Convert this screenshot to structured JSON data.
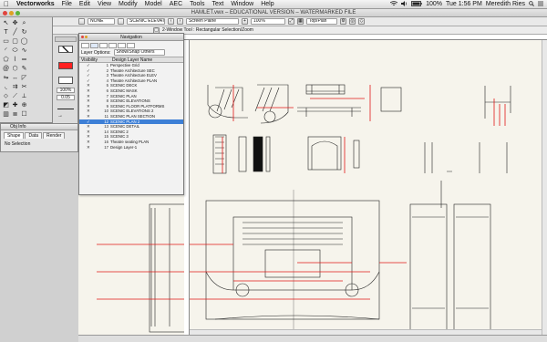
{
  "menubar": {
    "apple": "",
    "items": [
      "Vectorworks",
      "File",
      "Edit",
      "View",
      "Modify",
      "Model",
      "AEC",
      "Tools",
      "Text",
      "Window",
      "Help"
    ],
    "status_percent": "100%",
    "clock": "Tue 1:56 PM",
    "user": "Meredith Ries"
  },
  "window": {
    "title": "HAMLET.vwx – EDUCATIONAL VERSION – WATERMARKED FILE"
  },
  "viewbar": {
    "class_combo": "NONE",
    "layer_combo": "SCENIC ELEVATIONS",
    "view_combo": "Screen Plane",
    "zoom_combo": "100%",
    "render_combo": "Top/Plan"
  },
  "modebar": {
    "text": "2-Window Tool : Rectangular Selection/Zoom"
  },
  "attributes": {
    "fill_color": "#ff2020",
    "pen_color": "#ffffff",
    "opacity_field": "100%",
    "line_field": "0.05"
  },
  "objinfo": {
    "title": "Obj Info",
    "tabs": [
      "Shape",
      "Data",
      "Render"
    ],
    "selection": "No Selection"
  },
  "navigation": {
    "title": "Navigation",
    "option_label": "Layer Options:",
    "option_value": "Show/Snap Others",
    "col_visibility": "Visibility",
    "col_name": "Design Layer Name",
    "layers": [
      {
        "vis": "✓",
        "num": "1",
        "name": "Perspective Grid",
        "selected": false
      },
      {
        "vis": "✓",
        "num": "2",
        "name": "Theatre Architecture SEC",
        "selected": false
      },
      {
        "vis": "✓",
        "num": "3",
        "name": "Theatre Architecture ELEV",
        "selected": false
      },
      {
        "vis": "✓",
        "num": "4",
        "name": "Theatre Architecture PLAN",
        "selected": false
      },
      {
        "vis": "✕",
        "num": "5",
        "name": "SCENIC DECK",
        "selected": false
      },
      {
        "vis": "✕",
        "num": "6",
        "name": "SCENIC MASK",
        "selected": false
      },
      {
        "vis": "✕",
        "num": "7",
        "name": "SCENIC PLAN",
        "selected": false
      },
      {
        "vis": "✕",
        "num": "8",
        "name": "SCENIC ELEVATIONS",
        "selected": false
      },
      {
        "vis": "✕",
        "num": "9",
        "name": "SCENIC FLOOR PLATFORMS",
        "selected": false
      },
      {
        "vis": "✕",
        "num": "10",
        "name": "SCENIC ELEVATIONS 2",
        "selected": false
      },
      {
        "vis": "✕",
        "num": "11",
        "name": "SCENIC PLAN SECTION",
        "selected": false
      },
      {
        "vis": "✓",
        "num": "12",
        "name": "SCENIC PLAN 2",
        "selected": true
      },
      {
        "vis": "✕",
        "num": "13",
        "name": "SCENIC DETAIL",
        "selected": false
      },
      {
        "vis": "✕",
        "num": "14",
        "name": "SCENIC 2",
        "selected": false
      },
      {
        "vis": "✕",
        "num": "15",
        "name": "SCENIC 3",
        "selected": false
      },
      {
        "vis": "✕",
        "num": "16",
        "name": "Theatre seating PLAN",
        "selected": false
      },
      {
        "vis": "✕",
        "num": "17",
        "name": "Design Layer-1",
        "selected": false
      }
    ]
  },
  "colors": {
    "selection": "#3d7fd6",
    "drawing_red": "#e01818",
    "canvas": "#f6f4ec"
  }
}
